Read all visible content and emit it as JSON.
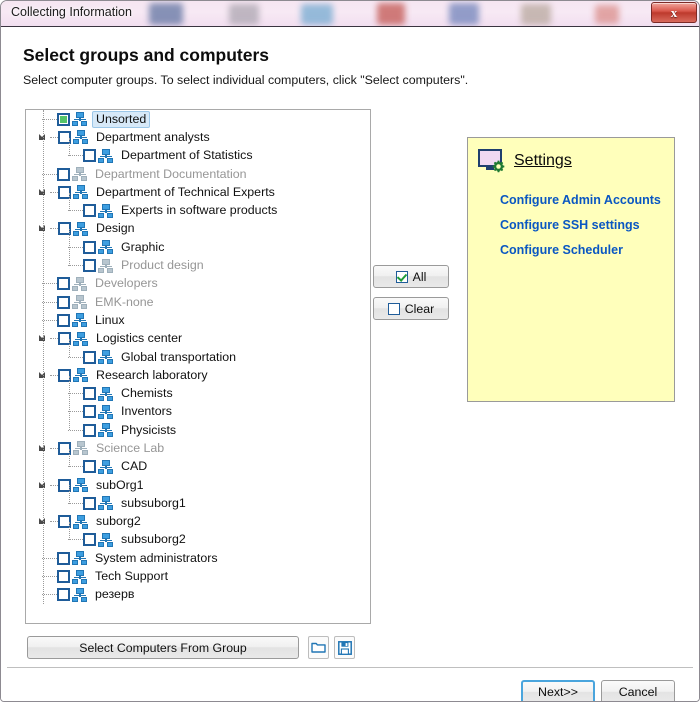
{
  "window": {
    "title": "Collecting Information",
    "close_icon": "close-icon",
    "close_label": "x"
  },
  "header": {
    "title": "Select groups and computers",
    "subtitle": "Select computer groups. To select individual computers, click \"Select computers\"."
  },
  "tree": {
    "nodes": [
      {
        "label": "Unsorted",
        "depth": 0,
        "checked": "partial",
        "expander": "none",
        "dim": false,
        "selected": true,
        "icon": "workgroup-icon"
      },
      {
        "label": "Department analysts",
        "depth": 0,
        "checked": "none",
        "expander": "open",
        "dim": false,
        "selected": false,
        "icon": "workgroup-icon"
      },
      {
        "label": "Department of Statistics",
        "depth": 1,
        "checked": "none",
        "expander": "none",
        "dim": false,
        "selected": false,
        "icon": "workgroup-icon"
      },
      {
        "label": "Department Documentation",
        "depth": 0,
        "checked": "none",
        "expander": "none",
        "dim": true,
        "selected": false,
        "icon": "workgroup-icon"
      },
      {
        "label": "Department of Technical Experts",
        "depth": 0,
        "checked": "none",
        "expander": "open",
        "dim": false,
        "selected": false,
        "icon": "workgroup-icon"
      },
      {
        "label": "Experts in software products",
        "depth": 1,
        "checked": "none",
        "expander": "none",
        "dim": false,
        "selected": false,
        "icon": "workgroup-icon"
      },
      {
        "label": "Design",
        "depth": 0,
        "checked": "none",
        "expander": "open",
        "dim": false,
        "selected": false,
        "icon": "workgroup-icon"
      },
      {
        "label": "Graphic",
        "depth": 1,
        "checked": "none",
        "expander": "none",
        "dim": false,
        "selected": false,
        "icon": "workgroup-icon"
      },
      {
        "label": "Product design",
        "depth": 1,
        "checked": "none",
        "expander": "none",
        "dim": true,
        "selected": false,
        "icon": "workgroup-icon"
      },
      {
        "label": "Developers",
        "depth": 0,
        "checked": "none",
        "expander": "none",
        "dim": true,
        "selected": false,
        "icon": "workgroup-icon"
      },
      {
        "label": "EMK-none",
        "depth": 0,
        "checked": "none",
        "expander": "none",
        "dim": true,
        "selected": false,
        "icon": "workgroup-icon"
      },
      {
        "label": "Linux",
        "depth": 0,
        "checked": "none",
        "expander": "none",
        "dim": false,
        "selected": false,
        "icon": "workgroup-icon"
      },
      {
        "label": "Logistics center",
        "depth": 0,
        "checked": "none",
        "expander": "open",
        "dim": false,
        "selected": false,
        "icon": "workgroup-icon"
      },
      {
        "label": "Global transportation",
        "depth": 1,
        "checked": "none",
        "expander": "none",
        "dim": false,
        "selected": false,
        "icon": "workgroup-icon"
      },
      {
        "label": "Research laboratory",
        "depth": 0,
        "checked": "none",
        "expander": "open",
        "dim": false,
        "selected": false,
        "icon": "workgroup-icon"
      },
      {
        "label": "Chemists",
        "depth": 1,
        "checked": "none",
        "expander": "none",
        "dim": false,
        "selected": false,
        "icon": "workgroup-icon"
      },
      {
        "label": "Inventors",
        "depth": 1,
        "checked": "none",
        "expander": "none",
        "dim": false,
        "selected": false,
        "icon": "workgroup-icon"
      },
      {
        "label": "Physicists",
        "depth": 1,
        "checked": "none",
        "expander": "none",
        "dim": false,
        "selected": false,
        "icon": "workgroup-icon"
      },
      {
        "label": "Science Lab",
        "depth": 0,
        "checked": "none",
        "expander": "open",
        "dim": true,
        "selected": false,
        "icon": "workgroup-icon"
      },
      {
        "label": "CAD",
        "depth": 1,
        "checked": "none",
        "expander": "none",
        "dim": false,
        "selected": false,
        "icon": "workgroup-icon"
      },
      {
        "label": "subOrg1",
        "depth": 0,
        "checked": "none",
        "expander": "open",
        "dim": false,
        "selected": false,
        "icon": "workgroup-icon"
      },
      {
        "label": "subsuborg1",
        "depth": 1,
        "checked": "none",
        "expander": "none",
        "dim": false,
        "selected": false,
        "icon": "workgroup-icon"
      },
      {
        "label": "suborg2",
        "depth": 0,
        "checked": "none",
        "expander": "open",
        "dim": false,
        "selected": false,
        "icon": "workgroup-icon"
      },
      {
        "label": "subsuborg2",
        "depth": 1,
        "checked": "none",
        "expander": "none",
        "dim": false,
        "selected": false,
        "icon": "workgroup-icon"
      },
      {
        "label": "System administrators",
        "depth": 0,
        "checked": "none",
        "expander": "none",
        "dim": false,
        "selected": false,
        "icon": "workgroup-icon"
      },
      {
        "label": "Tech Support",
        "depth": 0,
        "checked": "none",
        "expander": "none",
        "dim": false,
        "selected": false,
        "icon": "workgroup-icon"
      },
      {
        "label": "резерв",
        "depth": 0,
        "checked": "none",
        "expander": "none",
        "dim": false,
        "selected": false,
        "icon": "workgroup-icon"
      }
    ]
  },
  "selection_buttons": {
    "all_label": "All",
    "clear_label": "Clear"
  },
  "settings": {
    "icon": "monitor-gear-icon",
    "title": "Settings",
    "links": [
      "Configure Admin Accounts",
      "Configure SSH settings",
      "Configure Scheduler"
    ]
  },
  "tree_actions": {
    "select_computers_label": "Select Computers From Group",
    "open_icon": "folder-open-icon",
    "save_icon": "floppy-save-icon"
  },
  "footer": {
    "next_label": "Next>>",
    "cancel_label": "Cancel"
  },
  "colors": {
    "settings_panel_bg": "#ffffbb",
    "link_blue": "#0a57c2",
    "checkbox_border": "#1f5c99",
    "checkbox_fill_green": "#55c469",
    "group_icon_blue": "#3d9ee0",
    "selection_highlight": "#d7e9f8",
    "close_button_red": "#bd3a2d",
    "default_button_focus": "#4aa5dd",
    "titlebar_glass": "#f4e4f1"
  }
}
